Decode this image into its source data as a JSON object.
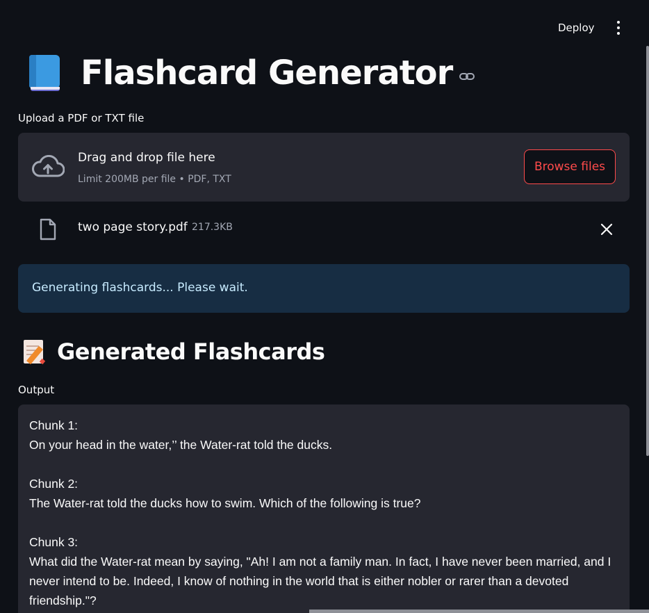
{
  "header": {
    "deploy_label": "Deploy",
    "menu_icon": "kebab-menu-icon"
  },
  "title": {
    "icon": "blue-book-icon",
    "text": "Flashcard Generator",
    "link_icon": "link-icon"
  },
  "uploader": {
    "label": "Upload a PDF or TXT file",
    "icon": "cloud-upload-icon",
    "drop_title": "Drag and drop file here",
    "drop_limit": "Limit 200MB per file • PDF, TXT",
    "browse_label": "Browse files"
  },
  "uploaded_file": {
    "icon": "file-icon",
    "name": "two page story.pdf",
    "size": "217.3KB",
    "remove_icon": "close-icon"
  },
  "info": {
    "message": "Generating flashcards... Please wait."
  },
  "flashcards": {
    "icon": "memo-icon",
    "heading": "Generated Flashcards",
    "output_label": "Output",
    "output_text": "Chunk 1:\nOn your head in the water,’’ the Water-rat told the ducks.\n\nChunk 2:\nThe Water-rat told the ducks how to swim. Which of the following is true?\n\nChunk 3:\nWhat did the Water-rat mean by saying, \"Ah! I am not a family man. In fact, I have never been married, and I never intend to be. Indeed, I know of nothing in the world that is either nobler or rarer than a devoted friendship.\"?"
  },
  "colors": {
    "background": "#0e1117",
    "surface": "#262730",
    "accent": "#ff4b4b",
    "info_bg": "#172d43",
    "info_text": "#c7ebff",
    "muted_text": "#a3a8b4"
  }
}
